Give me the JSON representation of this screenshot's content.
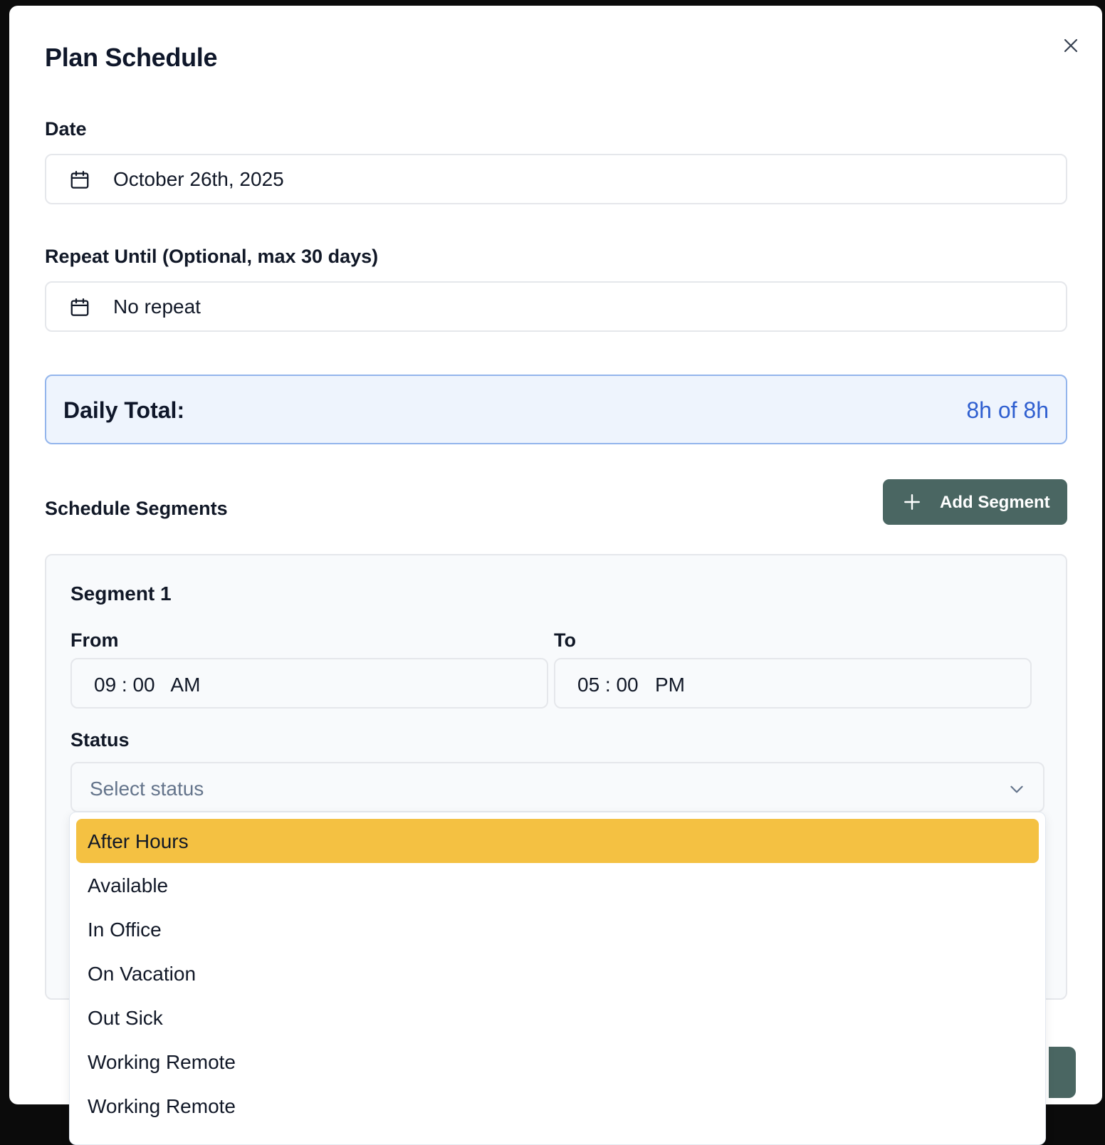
{
  "dialog": {
    "title": "Plan Schedule"
  },
  "date": {
    "label": "Date",
    "value": "October 26th, 2025"
  },
  "repeat": {
    "label": "Repeat Until (Optional, max 30 days)",
    "value": "No repeat"
  },
  "daily_total": {
    "label": "Daily Total:",
    "value": "8h of 8h"
  },
  "segments": {
    "header": "Schedule Segments",
    "add_label": "Add Segment",
    "items": [
      {
        "title": "Segment 1",
        "from_label": "From",
        "from_value": "09 : 00   AM",
        "to_label": "To",
        "to_value": "05 : 00   PM",
        "status_label": "Status",
        "status_placeholder": "Select status"
      }
    ]
  },
  "status_options": [
    "After Hours",
    "Available",
    "In Office",
    "On Vacation",
    "Out Sick",
    "Working Remote",
    "Working Remote"
  ],
  "highlighted_option": "After Hours",
  "colors": {
    "accent_button": "#4a6662",
    "highlight": "#f4c142",
    "total_value": "#2f5fd0",
    "total_bg": "#eef4fd"
  },
  "icons": {
    "close": "close-icon",
    "calendar": "calendar-icon",
    "plus": "plus-icon",
    "chevron": "chevron-down-icon"
  }
}
